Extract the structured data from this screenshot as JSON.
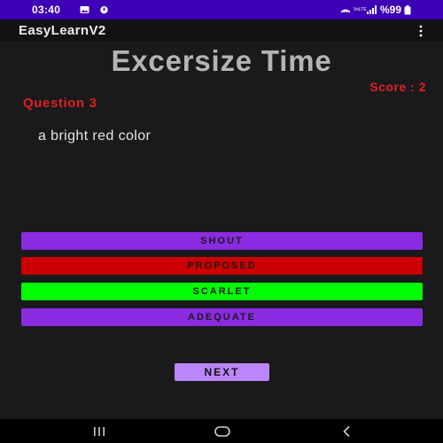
{
  "status_bar": {
    "time": "03:40",
    "network_label": "VoLTE",
    "battery": "%99",
    "icons": [
      "image-icon",
      "alarm-icon",
      "hotspot-icon",
      "signal-icon",
      "battery-icon"
    ]
  },
  "app_bar": {
    "title": "EasyLearnV2",
    "menu_icon": "overflow-menu-icon"
  },
  "quiz": {
    "heading": "Excersize Time",
    "score": "Score : 2",
    "question_number": "Question 3",
    "prompt": "a bright red color",
    "options": [
      {
        "label": "SHOUT",
        "color": "#8a2be2"
      },
      {
        "label": "PROPOSED",
        "color": "#cc0000"
      },
      {
        "label": "SCARLET",
        "color": "#00ff00"
      },
      {
        "label": "ADEQUATE",
        "color": "#8a2be2"
      }
    ],
    "next_label": "NEXT",
    "next_color": "#bb86fc"
  },
  "nav_bar": {
    "buttons": [
      "recent-apps-icon",
      "home-icon",
      "back-icon"
    ]
  },
  "colors": {
    "status_bar": "#3d00b4",
    "background": "#1a191b",
    "heading": "#b4b4b4",
    "accent_red": "#e02020"
  }
}
